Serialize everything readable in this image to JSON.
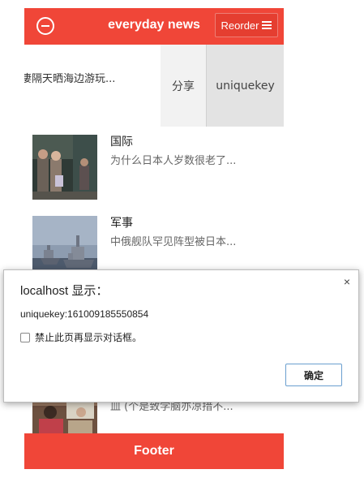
{
  "header": {
    "title": "everyday news",
    "reorder_label": "Reorder",
    "accent_color": "#f04638"
  },
  "swipe_row": {
    "text": "凄隔天晒海边游玩...",
    "actions": [
      "分享",
      "uniquekey"
    ]
  },
  "news": [
    {
      "category": "国际",
      "summary": "为什么日本人岁数很老了..."
    },
    {
      "category": "军事",
      "summary": "中俄舰队罕见阵型被日本..."
    },
    {
      "category": "",
      "summary": "皿 (个是致学脑亦凉措不..."
    }
  ],
  "footer": {
    "label": "Footer"
  },
  "dialog": {
    "title": "localhost 显示：",
    "message": "uniquekey:161009185550854",
    "checkbox_label": "禁止此页再显示对话框。",
    "ok_label": "确定",
    "close_icon": "×"
  }
}
